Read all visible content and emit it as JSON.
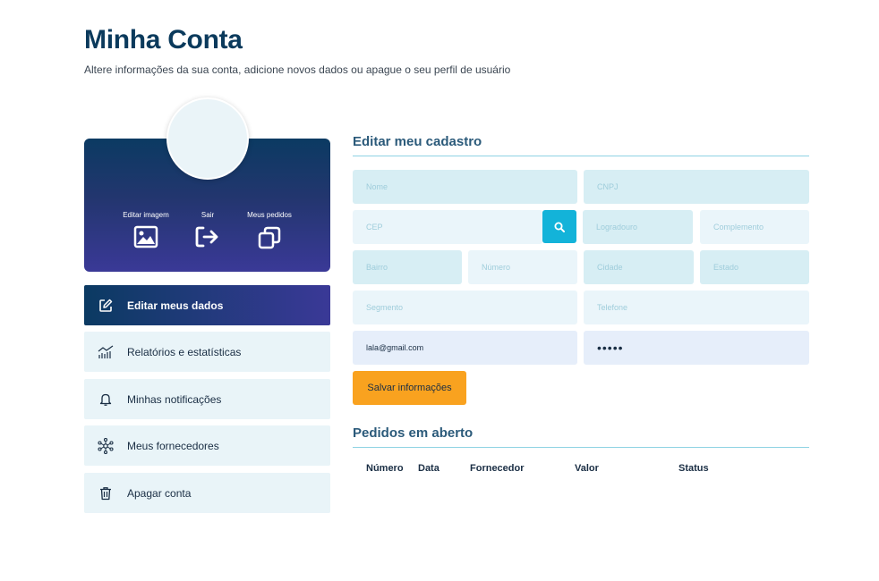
{
  "header": {
    "title": "Minha Conta",
    "subtitle": "Altere informações da sua conta, adicione novos dados ou apague o seu perfil de usuário"
  },
  "profile_card": {
    "actions": [
      {
        "label": "Editar imagem",
        "icon": "image-icon"
      },
      {
        "label": "Sair",
        "icon": "logout-icon"
      },
      {
        "label": "Meus pedidos",
        "icon": "copy-icon"
      }
    ]
  },
  "menu": {
    "items": [
      {
        "label": "Editar meus dados",
        "icon": "edit-icon",
        "active": true
      },
      {
        "label": "Relatórios e estatísticas",
        "icon": "chart-icon",
        "active": false
      },
      {
        "label": "Minhas notificações",
        "icon": "bell-icon",
        "active": false
      },
      {
        "label": "Meus fornecedores",
        "icon": "network-icon",
        "active": false
      },
      {
        "label": "Apagar conta",
        "icon": "trash-icon",
        "active": false
      }
    ]
  },
  "form": {
    "title": "Editar meu cadastro",
    "fields": {
      "nome": {
        "placeholder": "Nome",
        "value": ""
      },
      "cnpj": {
        "placeholder": "CNPJ",
        "value": ""
      },
      "cep": {
        "placeholder": "CEP",
        "value": ""
      },
      "logradouro": {
        "placeholder": "Logradouro",
        "value": ""
      },
      "complemento": {
        "placeholder": "Complemento",
        "value": ""
      },
      "bairro": {
        "placeholder": "Bairro",
        "value": ""
      },
      "numero": {
        "placeholder": "Número",
        "value": ""
      },
      "cidade": {
        "placeholder": "Cidade",
        "value": ""
      },
      "estado": {
        "placeholder": "Estado",
        "value": ""
      },
      "segmento": {
        "placeholder": "Segmento",
        "value": ""
      },
      "telefone": {
        "placeholder": "Telefone",
        "value": ""
      },
      "email": {
        "value": "lala@gmail.com"
      },
      "password": {
        "value": "•••••"
      }
    },
    "save_label": "Salvar informações"
  },
  "orders": {
    "title": "Pedidos em aberto",
    "columns": [
      "Número",
      "Data",
      "Fornecedor",
      "Valor",
      "Status"
    ]
  },
  "colors": {
    "brand_dark": "#0b3a5c",
    "gradient_start": "#0b3a62",
    "gradient_end": "#3a3997",
    "accent_cyan": "#13b3d9",
    "save_orange": "#f9a21f",
    "field_bg": "#d7eef4"
  }
}
